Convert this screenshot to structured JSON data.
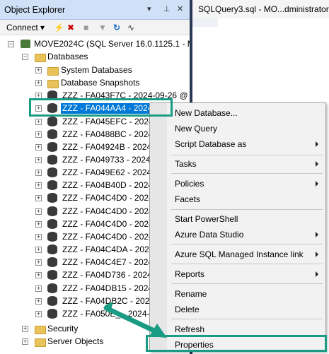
{
  "object_explorer": {
    "title": "Object Explorer",
    "pin_glyph": "▾ ⊣ ✕",
    "toolbar": {
      "connect_label": "Connect ▾"
    },
    "tree": {
      "server": "MOVE2024C (SQL Server 16.0.1125.1 - MC",
      "databases": "Databases",
      "system_databases": "System Databases",
      "database_snapshots": "Database Snapshots",
      "db_items": [
        "ZZZ - FA043F7C - 2024-09-26 @ 0",
        "ZZZ - FA044AA4 - 2024-",
        "ZZZ - FA045EFC - 2024-",
        "ZZZ - FA0488BC - 2024-",
        "ZZZ - FA04924B - 2024-",
        "ZZZ - FA049733 - 2024-",
        "ZZZ - FA049E62 - 2024-",
        "ZZZ - FA04B40D - 2024-",
        "ZZZ - FA04C4D0 - 2024-",
        "ZZZ - FA04C4D0 - 2024-",
        "ZZZ - FA04C4D0 - 2024-",
        "ZZZ - FA04C4D0 - 2024-",
        "ZZZ - FA04C4DA - 2024-",
        "ZZZ - FA04C4E7 - 2024-",
        "ZZZ - FA04D736 - 2024-",
        "ZZZ - FA04DB15 - 2024-",
        "ZZZ - FA04DB2C - 2024-",
        "ZZZ - FA050E_ - 2024-"
      ],
      "security": "Security",
      "server_objects": "Server Objects"
    }
  },
  "query_tab": {
    "title": "SQLQuery3.sql - MO...dministrator (6"
  },
  "context_menu": {
    "items": [
      {
        "label": "New Database...",
        "submenu": false
      },
      {
        "label": "New Query",
        "submenu": false
      },
      {
        "label": "Script Database as",
        "submenu": true
      },
      {
        "label": "Tasks",
        "submenu": true
      },
      {
        "label": "Policies",
        "submenu": true
      },
      {
        "label": "Facets",
        "submenu": false
      },
      {
        "label": "Start PowerShell",
        "submenu": false
      },
      {
        "label": "Azure Data Studio",
        "submenu": true
      },
      {
        "label": "Azure SQL Managed Instance link",
        "submenu": true
      },
      {
        "label": "Reports",
        "submenu": true
      },
      {
        "label": "Rename",
        "submenu": false
      },
      {
        "label": "Delete",
        "submenu": false
      },
      {
        "label": "Refresh",
        "submenu": false
      },
      {
        "label": "Properties",
        "submenu": false
      }
    ]
  },
  "colors": {
    "highlight": "#1a9c84",
    "selection": "#0078d7",
    "title_bar": "#cfe0f7"
  }
}
